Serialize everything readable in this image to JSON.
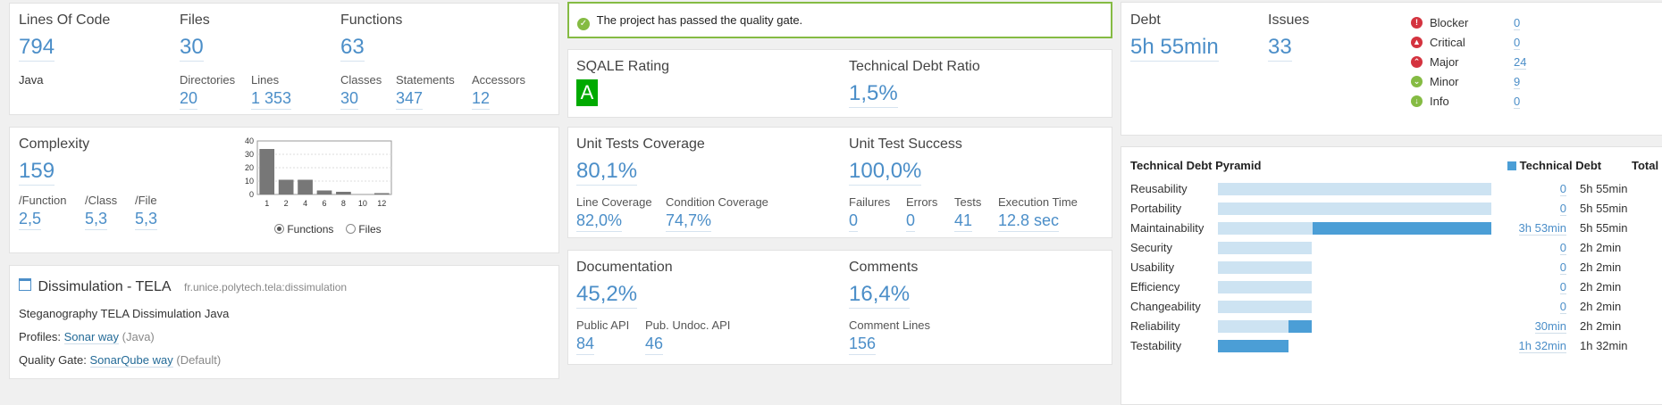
{
  "size": {
    "lines_of_code_label": "Lines Of Code",
    "lines_of_code": "794",
    "language": "Java",
    "files_label": "Files",
    "files": "30",
    "directories_label": "Directories",
    "directories": "20",
    "lines_label": "Lines",
    "lines": "1 353",
    "functions_label": "Functions",
    "functions": "63",
    "classes_label": "Classes",
    "classes": "30",
    "statements_label": "Statements",
    "statements": "347",
    "accessors_label": "Accessors",
    "accessors": "12"
  },
  "complexity": {
    "label": "Complexity",
    "value": "159",
    "per_function_label": "/Function",
    "per_function": "2,5",
    "per_class_label": "/Class",
    "per_class": "5,3",
    "per_file_label": "/File",
    "per_file": "5,3",
    "radio_functions": "Functions",
    "radio_files": "Files",
    "selected": "Functions"
  },
  "chart_data": {
    "type": "bar",
    "categories": [
      "1",
      "2",
      "4",
      "6",
      "8",
      "10",
      "12"
    ],
    "values": [
      34,
      11,
      11,
      3,
      2,
      0,
      1
    ],
    "y_ticks": [
      "0",
      "10",
      "20",
      "30",
      "40"
    ],
    "ylim": [
      0,
      40
    ],
    "grid": true,
    "bar_color": "#777777"
  },
  "project": {
    "name": "Dissimulation - TELA",
    "key": "fr.unice.polytech.tela:dissimulation",
    "description": "Steganography TELA Dissimulation Java",
    "profiles_label": "Profiles:",
    "profile_link": "Sonar way",
    "profile_lang": "(Java)",
    "quality_gate_label": "Quality Gate:",
    "quality_gate_link": "SonarQube way",
    "quality_gate_note": "(Default)"
  },
  "quality_gate": {
    "message": "The project has passed the quality gate.",
    "color": "#85bb43"
  },
  "sqale": {
    "rating_label": "SQALE Rating",
    "rating": "A",
    "rating_color": "#00aa00",
    "debt_ratio_label": "Technical Debt Ratio",
    "debt_ratio": "1,5%"
  },
  "tests": {
    "coverage_label": "Unit Tests Coverage",
    "coverage": "80,1%",
    "success_label": "Unit Test Success",
    "success": "100,0%",
    "line_coverage_label": "Line Coverage",
    "line_coverage": "82,0%",
    "condition_coverage_label": "Condition Coverage",
    "condition_coverage": "74,7%",
    "failures_label": "Failures",
    "failures": "0",
    "errors_label": "Errors",
    "errors": "0",
    "tests_label": "Tests",
    "tests": "41",
    "execution_time_label": "Execution Time",
    "execution_time": "12.8 sec"
  },
  "documentation": {
    "documentation_label": "Documentation",
    "documentation": "45,2%",
    "comments_label": "Comments",
    "comments": "16,4%",
    "public_api_label": "Public API",
    "public_api": "84",
    "pub_undoc_api_label": "Pub. Undoc. API",
    "pub_undoc_api": "46",
    "comment_lines_label": "Comment Lines",
    "comment_lines": "156"
  },
  "issues": {
    "debt_label": "Debt",
    "debt": "5h 55min",
    "issues_label": "Issues",
    "issues": "33",
    "severities": [
      {
        "name": "Blocker",
        "value": "0",
        "icon": "blocker-icon",
        "color": "#d4333f",
        "glyph": "!"
      },
      {
        "name": "Critical",
        "value": "0",
        "icon": "critical-icon",
        "color": "#d4333f",
        "glyph": "▲"
      },
      {
        "name": "Major",
        "value": "24",
        "icon": "major-icon",
        "color": "#d4333f",
        "glyph": "⌃"
      },
      {
        "name": "Minor",
        "value": "9",
        "icon": "minor-icon",
        "color": "#85bb43",
        "glyph": "⌄"
      },
      {
        "name": "Info",
        "value": "0",
        "icon": "info-icon",
        "color": "#85bb43",
        "glyph": "↓"
      }
    ]
  },
  "pyramid": {
    "title": "Technical Debt Pyramid",
    "legend_debt": "Technical Debt",
    "legend_total": "Total",
    "legend_color": "#4b9ed6",
    "rows": [
      {
        "name": "Reusability",
        "debt": "0",
        "total": "5h 55min",
        "total_frac": 1.0,
        "debt_frac": 0.0
      },
      {
        "name": "Portability",
        "debt": "0",
        "total": "5h 55min",
        "total_frac": 1.0,
        "debt_frac": 0.0
      },
      {
        "name": "Maintainability",
        "debt": "3h 53min",
        "total": "5h 55min",
        "total_frac": 1.0,
        "debt_frac": 0.655
      },
      {
        "name": "Security",
        "debt": "0",
        "total": "2h 2min",
        "total_frac": 0.344,
        "debt_frac": 0.0
      },
      {
        "name": "Usability",
        "debt": "0",
        "total": "2h 2min",
        "total_frac": 0.344,
        "debt_frac": 0.0
      },
      {
        "name": "Efficiency",
        "debt": "0",
        "total": "2h 2min",
        "total_frac": 0.344,
        "debt_frac": 0.0
      },
      {
        "name": "Changeability",
        "debt": "0",
        "total": "2h 2min",
        "total_frac": 0.344,
        "debt_frac": 0.0
      },
      {
        "name": "Reliability",
        "debt": "30min",
        "total": "2h 2min",
        "total_frac": 0.344,
        "debt_frac": 0.085
      },
      {
        "name": "Testability",
        "debt": "1h 32min",
        "total": "1h 32min",
        "total_frac": 0.259,
        "debt_frac": 0.259
      }
    ]
  }
}
